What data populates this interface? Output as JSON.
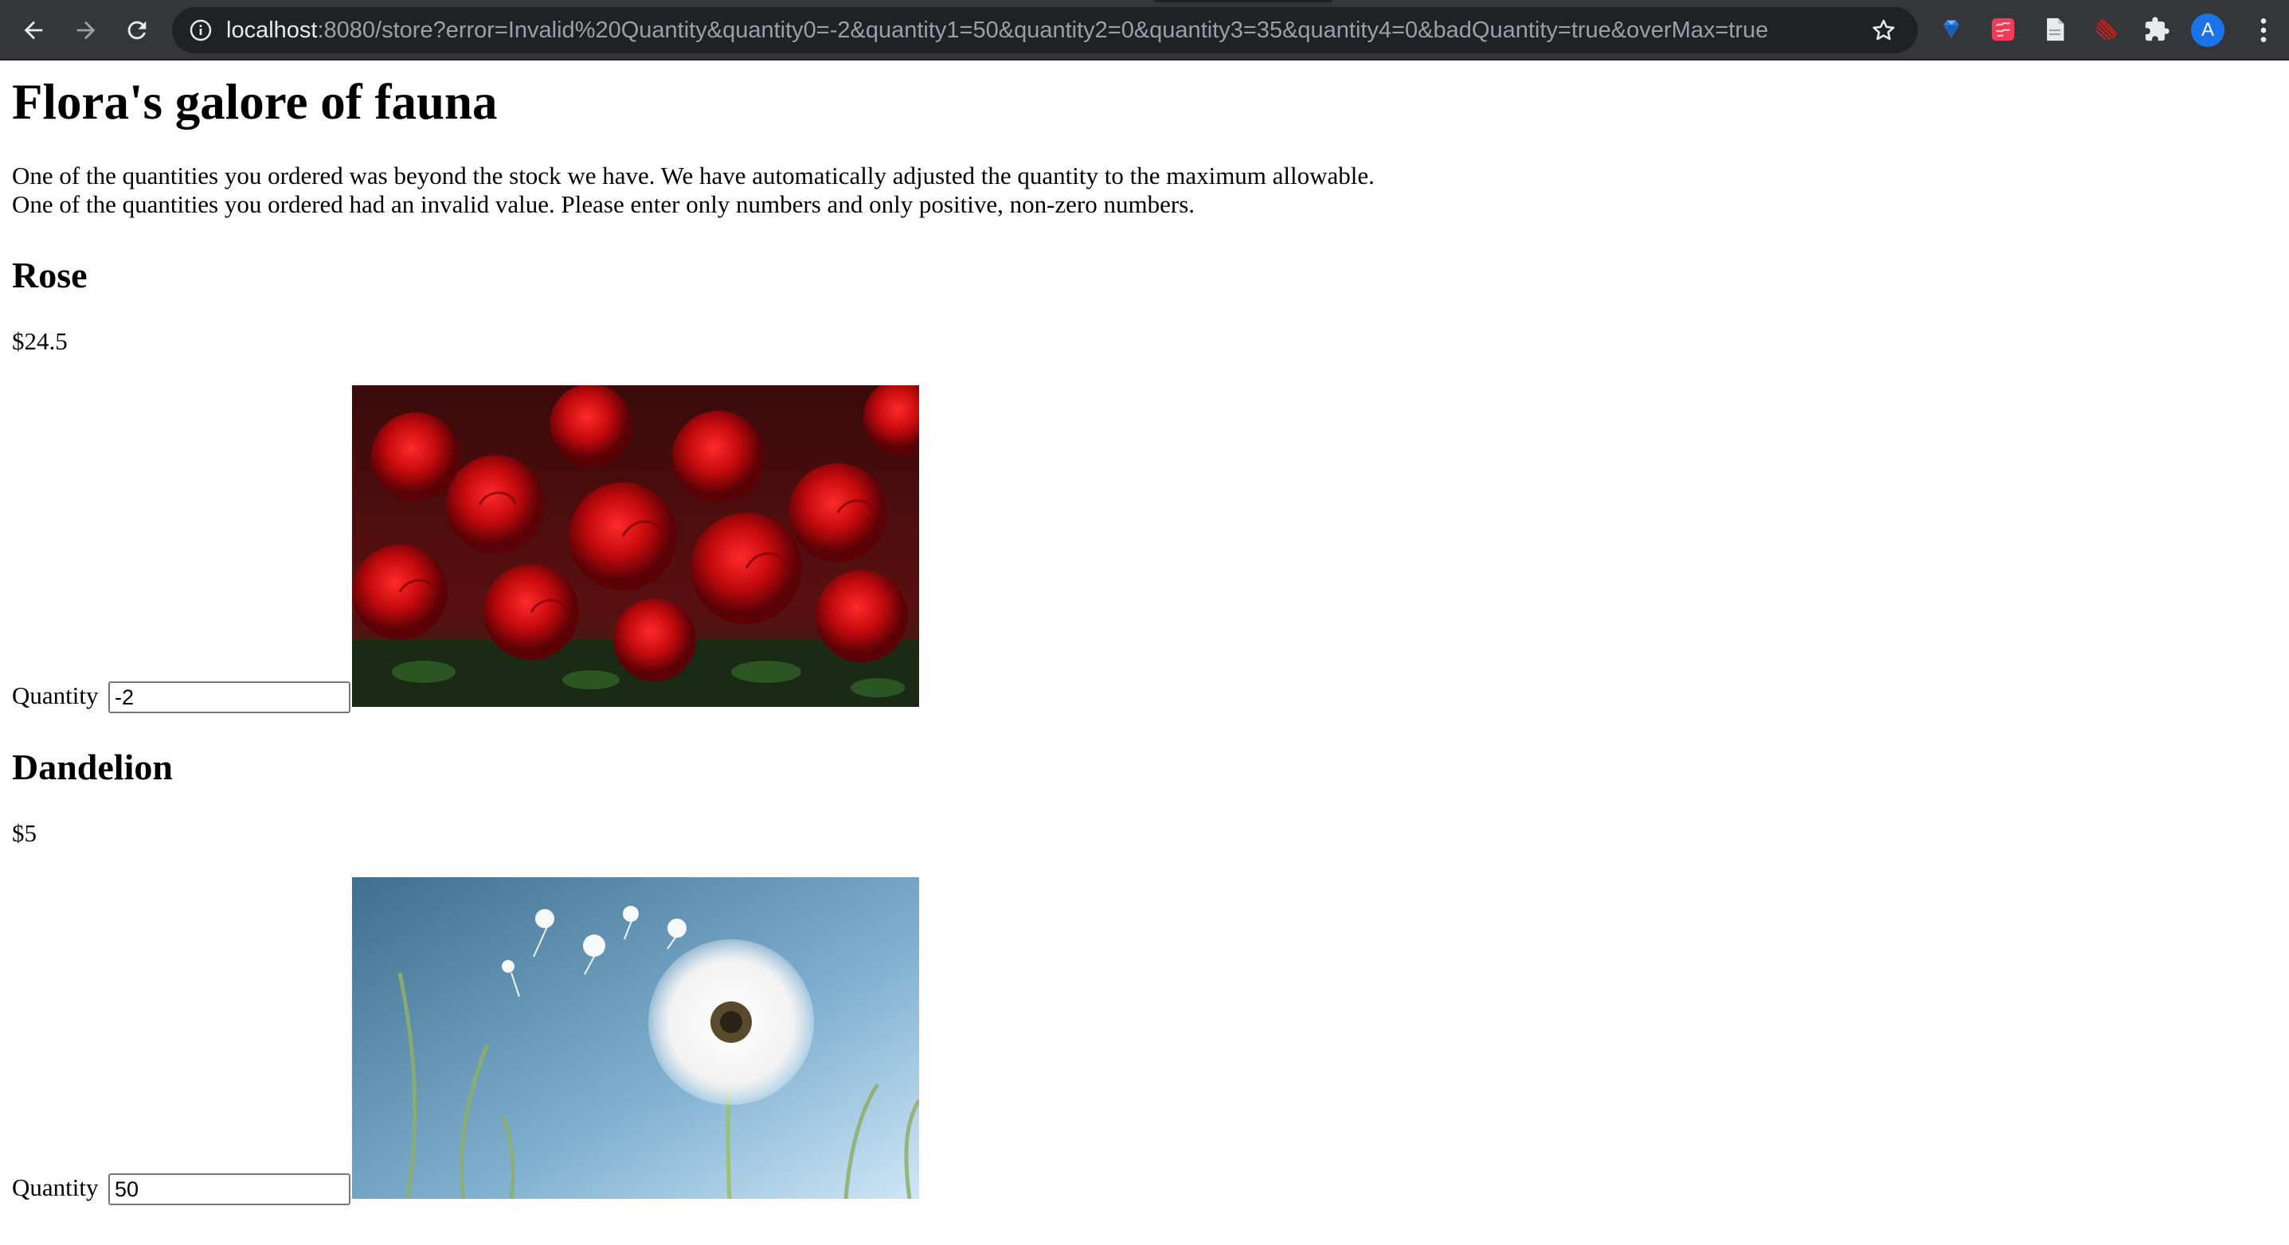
{
  "browser": {
    "url_host": "localhost",
    "url_rest": ":8080/store?error=Invalid%20Quantity&quantity0=-2&quantity1=50&quantity2=0&quantity3=35&quantity4=0&badQuantity=true&overMax=true",
    "profile_initial": "A",
    "icons": [
      "back-icon",
      "forward-icon",
      "reload-icon",
      "info-icon",
      "bookmark-star-icon",
      "gem-extension-icon",
      "red-extension-icon",
      "document-extension-icon",
      "striped-extension-icon",
      "puzzle-extensions-icon",
      "menu-kebab-icon"
    ]
  },
  "page": {
    "title": "Flora's galore of fauna",
    "messages": [
      "One of the quantities you ordered was beyond the stock we have. We have automatically adjusted the quantity to the maximum allowable.",
      "One of the quantities you ordered had an invalid value. Please enter only numbers and only positive, non-zero numbers."
    ],
    "quantity_label": "Quantity",
    "products": [
      {
        "name": "Rose",
        "price": "$24.5",
        "quantity": "-2",
        "image": "red-roses-photo"
      },
      {
        "name": "Dandelion",
        "price": "$5",
        "quantity": "50",
        "image": "dandelion-photo"
      }
    ]
  },
  "colors": {
    "toolbar_bg": "#35363a",
    "omnibox_bg": "#202124",
    "url_host": "#e8eaed",
    "url_rest": "#9aa0a6",
    "avatar": "#1a73e8"
  }
}
